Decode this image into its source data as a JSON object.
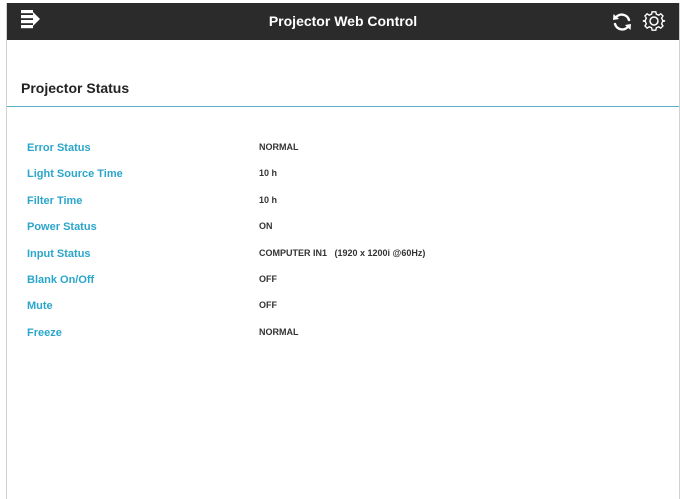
{
  "header": {
    "title": "Projector Web Control",
    "menu_icon": "menu-icon",
    "refresh_icon": "refresh-icon",
    "settings_icon": "gear-icon"
  },
  "section": {
    "title": "Projector Status"
  },
  "status_rows": [
    {
      "label": "Error Status",
      "value": "NORMAL"
    },
    {
      "label": "Light Source Time",
      "value": "10 h"
    },
    {
      "label": "Filter Time",
      "value": "10 h"
    },
    {
      "label": "Power Status",
      "value": "ON"
    },
    {
      "label": "Input Status",
      "value": "COMPUTER IN1   (1920 x 1200i @60Hz)"
    },
    {
      "label": "Blank On/Off",
      "value": "OFF"
    },
    {
      "label": "Mute",
      "value": "OFF"
    },
    {
      "label": "Freeze",
      "value": "NORMAL"
    }
  ],
  "colors": {
    "header_bg": "#2b2b2b",
    "label_color": "#2ba6cb",
    "rule_color": "#5bb3c9",
    "value_color": "#333333"
  }
}
